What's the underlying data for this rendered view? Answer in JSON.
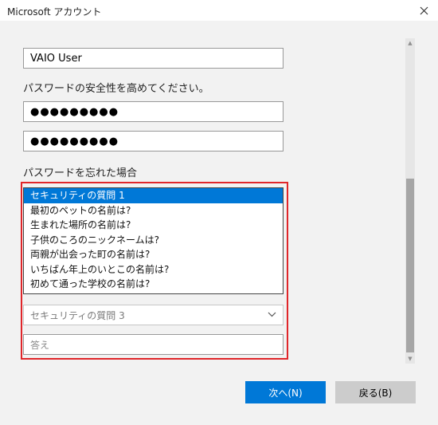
{
  "window": {
    "title": "Microsoft アカウント"
  },
  "form": {
    "username_value": "VAIO User",
    "password_prompt": "パスワードの安全性を高めてください。",
    "password_value": "●●●●●●●●●",
    "password_confirm_value": "●●●●●●●●●",
    "forgot_label": "パスワードを忘れた場合",
    "security_options": [
      "セキュリティの質問 1",
      "最初のペットの名前は?",
      "生まれた場所の名前は?",
      "子供のころのニックネームは?",
      "両親が出会った町の名前は?",
      "いちばん年上のいとこの名前は?",
      "初めて通った学校の名前は?"
    ],
    "security_question3_value": "セキュリティの質問 3",
    "answer_placeholder": "答え"
  },
  "buttons": {
    "next_label": "次へ(N)",
    "back_label": "戻る(B)"
  },
  "colors": {
    "accent": "#0078d7",
    "highlight_border": "#e0262a",
    "background": "#f2f2f2"
  }
}
